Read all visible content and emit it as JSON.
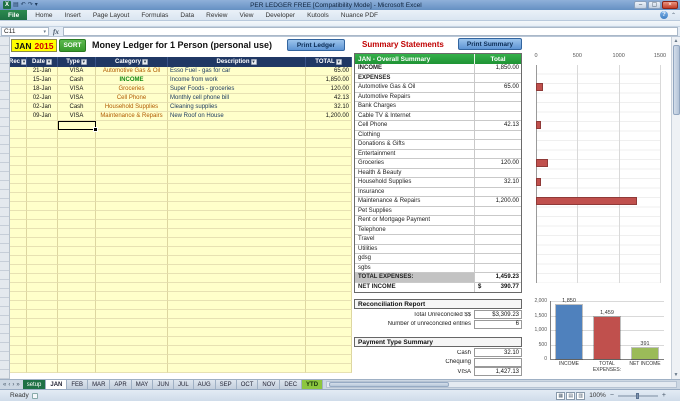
{
  "window": {
    "title": "PER LEDGER FREE  [Compatibility Mode] - Microsoft Excel",
    "controls": {
      "minimize": "–",
      "maximize": "▢",
      "close": "×"
    }
  },
  "ribbon": {
    "file_tab": "File",
    "tabs": [
      "Home",
      "Insert",
      "Page Layout",
      "Formulas",
      "Data",
      "Review",
      "View",
      "Developer",
      "Kutools",
      "Nuance PDF"
    ],
    "help_icon": "?"
  },
  "formula_bar": {
    "name_box": "C11",
    "fx": "fx"
  },
  "ledger": {
    "month": "JAN",
    "year": "2015",
    "sort_button": "SORT",
    "title": "Money Ledger for 1 Person (personal use)",
    "print_button": "Print Ledger",
    "columns": [
      "Rec",
      "Date",
      "Type",
      "Category",
      "Description",
      "TOTAL"
    ],
    "rows": [
      {
        "date": "21-Jan",
        "type": "VISA",
        "category": "Automotive Gas & Oil",
        "description": "Esso Fuel - gas for car",
        "total": "65.00"
      },
      {
        "date": "15-Jan",
        "type": "Cash",
        "category": "INCOME",
        "description": "Income from work",
        "total": "1,850.00"
      },
      {
        "date": "18-Jan",
        "type": "VISA",
        "category": "Groceries",
        "description": "Super Foods - groceries",
        "total": "120.00"
      },
      {
        "date": "02-Jan",
        "type": "VISA",
        "category": "Cell Phone",
        "description": "Monthly cell phone bill",
        "total": "42.13"
      },
      {
        "date": "02-Jan",
        "type": "Cash",
        "category": "Household Supplies",
        "description": "Cleaning supplies",
        "total": "32.10"
      },
      {
        "date": "09-Jan",
        "type": "VISA",
        "category": "Maintenance & Repairs",
        "description": "New Roof on House",
        "total": "1,200.00"
      }
    ]
  },
  "summary": {
    "title": "Summary Statements",
    "print_button": "Print Summary",
    "header_label": "JAN - Overall Summary",
    "header_total": "Total",
    "income_label": "INCOME",
    "income_value": "1,850.00",
    "expenses_label": "EXPENSES",
    "expense_rows": [
      {
        "label": "Automotive Gas & Oil",
        "value": "65.00"
      },
      {
        "label": "Automotive Repairs",
        "value": ""
      },
      {
        "label": "Bank Charges",
        "value": ""
      },
      {
        "label": "Cable TV & Internet",
        "value": ""
      },
      {
        "label": "Cell Phone",
        "value": "42.13"
      },
      {
        "label": "Clothing",
        "value": ""
      },
      {
        "label": "Donations & Gifts",
        "value": ""
      },
      {
        "label": "Entertainment",
        "value": ""
      },
      {
        "label": "Groceries",
        "value": "120.00"
      },
      {
        "label": "Health & Beauty",
        "value": ""
      },
      {
        "label": "Household Supplies",
        "value": "32.10"
      },
      {
        "label": "Insurance",
        "value": ""
      },
      {
        "label": "Maintenance & Repairs",
        "value": "1,200.00"
      },
      {
        "label": "Pet Supplies",
        "value": ""
      },
      {
        "label": "Rent or Mortgage Payment",
        "value": ""
      },
      {
        "label": "Telephone",
        "value": ""
      },
      {
        "label": "Travel",
        "value": ""
      },
      {
        "label": "Utilities",
        "value": ""
      },
      {
        "label": "gdsg",
        "value": ""
      },
      {
        "label": "sgbs",
        "value": ""
      }
    ],
    "total_expenses_label": "TOTAL EXPENSES:",
    "total_expenses_value": "1,459.23",
    "net_income_label": "NET INCOME",
    "net_income_currency": "$",
    "net_income_value": "390.77"
  },
  "reconciliation": {
    "title": "Reconciliation Report",
    "rows": [
      {
        "label": "Total Unreconciled $$",
        "value": "$3,309.23"
      },
      {
        "label": "Number of unreconciled entries",
        "value": "6"
      }
    ]
  },
  "payment_summary": {
    "title": "Payment Type Summary",
    "rows": [
      {
        "label": "Cash",
        "value": "32.10"
      },
      {
        "label": "Chequing",
        "value": ""
      },
      {
        "label": "VISA",
        "value": "1,427.13"
      }
    ]
  },
  "chart_data": [
    {
      "type": "bar",
      "orientation": "horizontal",
      "title": "",
      "categories": [
        "Automotive Gas & Oil",
        "Automotive Repairs",
        "Bank Charges",
        "Cable TV & Internet",
        "Cell Phone",
        "Clothing",
        "Donations & Gifts",
        "Entertainment",
        "Groceries",
        "Health & Beauty",
        "Household Supplies",
        "Insurance",
        "Maintenance & Repairs",
        "Pet Supplies",
        "Rent or Mortgage Payment",
        "Telephone",
        "Travel",
        "Utilities",
        "gdsg",
        "sgbs"
      ],
      "values": [
        65,
        0,
        0,
        0,
        42.13,
        0,
        0,
        0,
        120,
        0,
        32.1,
        0,
        1200,
        0,
        0,
        0,
        0,
        0,
        0,
        0
      ],
      "xlim": [
        0,
        1500
      ],
      "xticks": [
        0,
        500,
        1000,
        1500
      ],
      "xtick_labels": [
        "0",
        "500",
        "1000",
        "1500"
      ],
      "bar_color": "#C0504D",
      "grid": true,
      "legend": false
    },
    {
      "type": "bar",
      "orientation": "vertical",
      "title": "",
      "categories": [
        "INCOME",
        "TOTAL EXPENSES:",
        "NET INCOME"
      ],
      "values": [
        1850,
        1459,
        391
      ],
      "labels": [
        "1,850",
        "1,459",
        "391"
      ],
      "colors": [
        "#4F81BD",
        "#C0504D",
        "#9BBB59"
      ],
      "ylim": [
        0,
        2000
      ],
      "yticks": [
        0,
        500,
        1000,
        1500,
        2000
      ],
      "ytick_labels": [
        "0",
        "500",
        "1,000",
        "1,500",
        "2,000"
      ],
      "grid": true,
      "legend": false
    }
  ],
  "sheet_tabs": {
    "tabs": [
      {
        "label": "setup",
        "style": "green-dark"
      },
      {
        "label": "JAN",
        "style": "active"
      },
      {
        "label": "FEB",
        "style": "normal"
      },
      {
        "label": "MAR",
        "style": "normal"
      },
      {
        "label": "APR",
        "style": "normal"
      },
      {
        "label": "MAY",
        "style": "normal"
      },
      {
        "label": "JUN",
        "style": "normal"
      },
      {
        "label": "JUL",
        "style": "normal"
      },
      {
        "label": "AUG",
        "style": "normal"
      },
      {
        "label": "SEP",
        "style": "normal"
      },
      {
        "label": "OCT",
        "style": "normal"
      },
      {
        "label": "NOV",
        "style": "normal"
      },
      {
        "label": "DEC",
        "style": "normal"
      },
      {
        "label": "YTD",
        "style": "green"
      }
    ]
  },
  "status_bar": {
    "ready": "Ready",
    "zoom": "100%"
  }
}
